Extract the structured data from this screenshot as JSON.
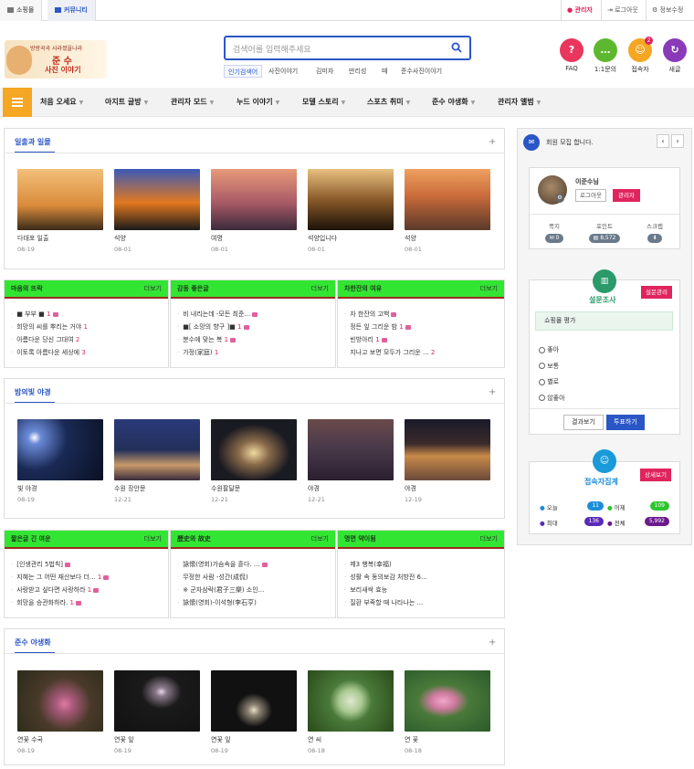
{
  "topbar": {
    "tab1": "소핑몰",
    "tab2": "커뮤니티",
    "admin": "관리자",
    "logout": "로그아웃",
    "edit": "정보수정"
  },
  "logo": {
    "line1": "방방곡곡 사라졌을나라",
    "line2": "준  수",
    "line3": "사진 이야기"
  },
  "search": {
    "placeholder": "검색어를 입력해주세요",
    "popular_label": "인기검색어",
    "popular": [
      "사진이야기",
      "김미자",
      "만리성",
      "때",
      "준수사진이야기"
    ]
  },
  "quick": [
    {
      "label": "FAQ",
      "icon": "question-icon",
      "color": "#e8365d",
      "glyph": "?"
    },
    {
      "label": "1:1문의",
      "icon": "chat-icon",
      "color": "#5db82f",
      "glyph": "…"
    },
    {
      "label": "접속자",
      "icon": "users-icon",
      "color": "#f5a623",
      "glyph": "☺",
      "badge": "2"
    },
    {
      "label": "새글",
      "icon": "refresh-icon",
      "color": "#8a3ab9",
      "glyph": "↻"
    }
  ],
  "nav": [
    "처음 오세요",
    "아지트 글방",
    "관리자 모드",
    "누드 이야기",
    "모델 스토리",
    "스포츠 취미",
    "준수 야생화",
    "관리자 앨범"
  ],
  "sec1": {
    "title": "일출과 일몰",
    "items": [
      {
        "cap": "다대포 일출",
        "date": "08-19",
        "color": "#d98a3a"
      },
      {
        "cap": "석양",
        "date": "08-01",
        "color": "#e2781f"
      },
      {
        "cap": "여명",
        "date": "08-01",
        "color": "#a85a66"
      },
      {
        "cap": "석양입니다",
        "date": "08-01",
        "color": "#3a2a1a"
      },
      {
        "cap": "석양",
        "date": "08-01",
        "color": "#c86a3a"
      }
    ]
  },
  "grp1": [
    {
      "title": "마음의 뜨락",
      "more": "더보기",
      "items": [
        {
          "t": "■ 부부 ■",
          "c": "1",
          "b": true
        },
        {
          "t": "희망의 씨를 뿌리는 거야",
          "c": "1",
          "b": false
        },
        {
          "t": "아름다운 당신 그대여",
          "c": "2",
          "b": false
        },
        {
          "t": "이토록 아름다운 세상에",
          "c": "3",
          "b": false
        }
      ]
    },
    {
      "title": "감동 좋은글",
      "more": "더보기",
      "items": [
        {
          "t": "비 내리는데 -모든 최준...",
          "c": "",
          "b": true
        },
        {
          "t": "■[ 소망의 향구 ]■",
          "c": "1",
          "b": true
        },
        {
          "t": "분수에 맞는 복",
          "c": "1",
          "b": true
        },
        {
          "t": "가정(家庭)",
          "c": "1",
          "b": false
        }
      ]
    },
    {
      "title": "차한잔의 여유",
      "more": "더보기",
      "items": [
        {
          "t": "자 한잔의 고백",
          "c": "",
          "b": true
        },
        {
          "t": "정든 잎 그리운 밤",
          "c": "1",
          "b": true
        },
        {
          "t": "빈방아리",
          "c": "1",
          "b": true
        },
        {
          "t": "지나고 보면 모두가 그리운 ...",
          "c": "2",
          "b": false
        }
      ]
    }
  ],
  "sec2": {
    "title": "밤의빛 야경",
    "items": [
      {
        "cap": "빛 야경",
        "date": "08-19",
        "color": "#1a2a55"
      },
      {
        "cap": "수원 장안문",
        "date": "12-21",
        "color": "#23305a"
      },
      {
        "cap": "수원팔달문",
        "date": "12-21",
        "color": "#1a1a22"
      },
      {
        "cap": "야경",
        "date": "12-21",
        "color": "#4a3a4a"
      },
      {
        "cap": "야경",
        "date": "12-19",
        "color": "#3a2a2a"
      }
    ]
  },
  "grp2": [
    {
      "title": "짧은글 긴 여운",
      "more": "더보기",
      "items": [
        {
          "t": "[인생관리 5법칙]",
          "c": "",
          "b": true
        },
        {
          "t": "지혜는 그 어떤 재산보다 더...",
          "c": "1",
          "b": true
        },
        {
          "t": "사랑받고 싶다면 사랑하라",
          "c": "1",
          "b": true
        },
        {
          "t": "희망을 승관화하라.",
          "c": "1",
          "b": true
        }
      ]
    },
    {
      "title": "歷史와 故史",
      "more": "더보기",
      "items": [
        {
          "t": "詠懷(영회)가슴속을 흩다. ...",
          "c": "",
          "b": true
        },
        {
          "t": "무정한 사람 -성간(成侃)",
          "c": "",
          "b": false
        },
        {
          "t": "※ 군자삼락(君子三樂) 소인...",
          "c": "",
          "b": false
        },
        {
          "t": "詠懷(영회)-이석형(李石亨)",
          "c": "",
          "b": false
        }
      ]
    },
    {
      "title": "명면 약이됨",
      "more": "더보기",
      "items": [
        {
          "t": "제3 행복(幸福)",
          "c": "",
          "b": false
        },
        {
          "t": "성활 속 동의보감 처방전 6...",
          "c": "",
          "b": false
        },
        {
          "t": "보리새싹 효능",
          "c": "",
          "b": false
        },
        {
          "t": "질환 부족할 때 나타나는 ...",
          "c": "",
          "b": false
        }
      ]
    }
  ],
  "sec3": {
    "title": "준수 야생화",
    "items": [
      {
        "cap": "연꽃 수국",
        "date": "08-19",
        "color": "#4a3a2a"
      },
      {
        "cap": "연꽃 잎",
        "date": "08-19",
        "color": "#2a2a2a"
      },
      {
        "cap": "연꽃 잎",
        "date": "08-19",
        "color": "#111"
      },
      {
        "cap": "연 씨",
        "date": "08-18",
        "color": "#2a4a1a"
      },
      {
        "cap": "연 꽃",
        "date": "08-18",
        "color": "#2a5a2a"
      }
    ]
  },
  "notice": {
    "text": "회원 모집 합니다."
  },
  "member": {
    "name": "이준수님",
    "logout": "로그아웃",
    "admin": "관리자",
    "stats": [
      {
        "label": "쪽지",
        "val": "0"
      },
      {
        "label": "포인트",
        "val": "8,572"
      },
      {
        "label": "스크랩",
        "val": ""
      }
    ]
  },
  "poll": {
    "title": "설문조사",
    "admin": "설문관리",
    "question": "쇼핑몰 평가",
    "options": [
      "좋아",
      "보통",
      "별로",
      "않좋아"
    ],
    "result": "결과보기",
    "vote": "투표하기"
  },
  "visit": {
    "title": "접속자집계",
    "detail": "상세보기",
    "rows": [
      {
        "l": "오늘",
        "v": "11",
        "c": "#1a8fd8"
      },
      {
        "l": "어제",
        "v": "109",
        "c": "#2ec52e"
      },
      {
        "l": "최대",
        "v": "136",
        "c": "#5a2ab8"
      },
      {
        "l": "전체",
        "v": "5,992",
        "c": "#6a1a8a"
      }
    ]
  }
}
